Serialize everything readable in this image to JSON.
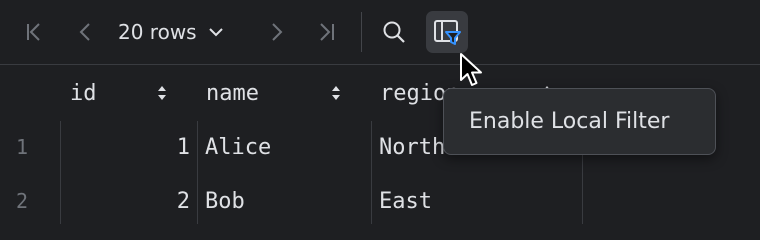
{
  "toolbar": {
    "rows_label": "20 rows",
    "buttons": [
      {
        "icon": "first-page-icon"
      },
      {
        "icon": "previous-page-icon"
      },
      {
        "icon": "next-page-icon"
      },
      {
        "icon": "last-page-icon"
      },
      {
        "icon": "search-icon"
      },
      {
        "icon": "local-filter-icon"
      }
    ]
  },
  "table": {
    "columns": [
      {
        "label": "id"
      },
      {
        "label": "name"
      },
      {
        "label": "region"
      }
    ],
    "rows": [
      {
        "num": "1",
        "id": "1",
        "name": "Alice",
        "region": "North"
      },
      {
        "num": "2",
        "id": "2",
        "name": "Bob",
        "region": "East"
      }
    ]
  },
  "tooltip": {
    "text": "Enable Local Filter"
  },
  "colors": {
    "background": "#1e1f22",
    "accent": "#3592ff",
    "tooltip_bg": "#2b2d30"
  }
}
